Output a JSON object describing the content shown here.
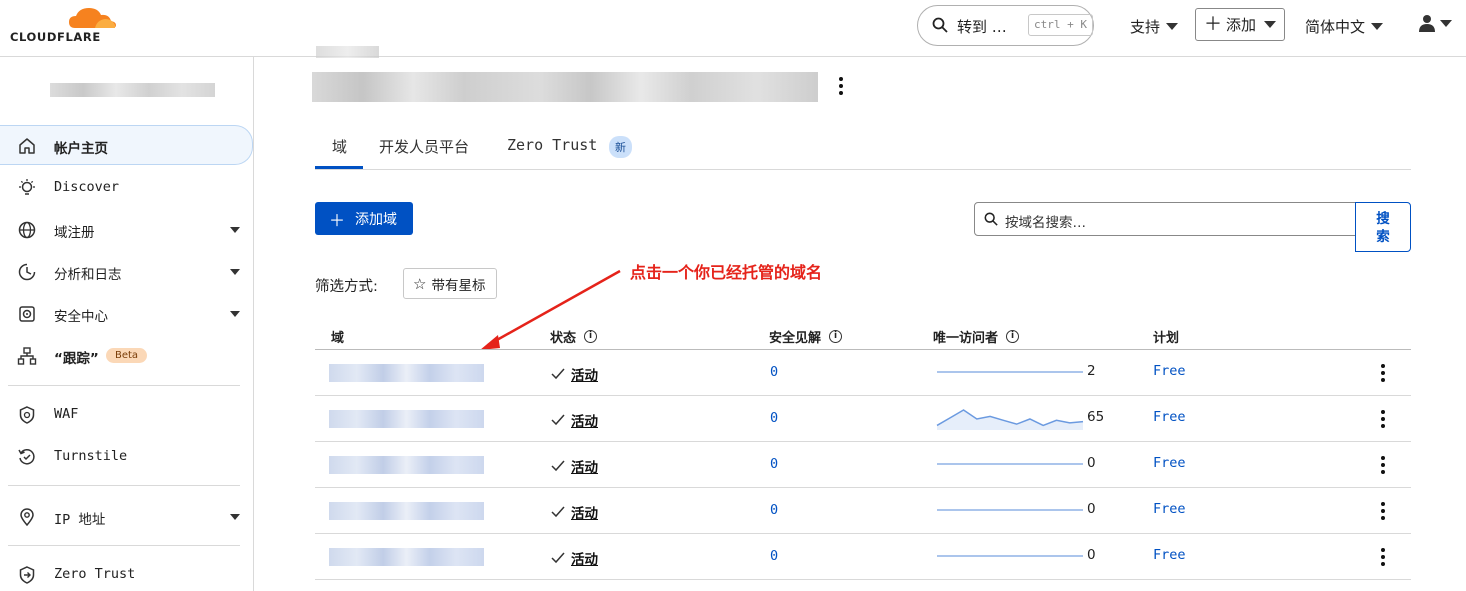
{
  "topbar": {
    "brand": "CLOUDFLARE",
    "goto_label": "转到 …",
    "goto_shortcut": "ctrl + K",
    "support": "支持",
    "add": "添加",
    "language": "简体中文"
  },
  "sidebar": {
    "items": [
      {
        "label": "帐户主页",
        "icon": "home-icon",
        "active": true
      },
      {
        "label": "Discover",
        "icon": "lightbulb-icon"
      },
      {
        "label": "域注册",
        "icon": "globe-icon",
        "expand": true
      },
      {
        "label": "分析和日志",
        "icon": "chart-clock-icon",
        "expand": true
      },
      {
        "label": "安全中心",
        "icon": "shield-target-icon",
        "expand": true
      },
      {
        "label": "“跟踪”",
        "icon": "sitemap-icon",
        "badge": "Beta"
      },
      {
        "label": "WAF",
        "icon": "waf-shield-icon"
      },
      {
        "label": "Turnstile",
        "icon": "turnstile-icon"
      },
      {
        "label": "IP 地址",
        "icon": "location-pin-icon",
        "expand": true
      },
      {
        "label": "Zero Trust",
        "icon": "zero-trust-icon"
      }
    ]
  },
  "main": {
    "tabs": [
      {
        "label": "域",
        "active": true
      },
      {
        "label": "开发人员平台"
      },
      {
        "label": "Zero Trust",
        "badge": "新"
      }
    ],
    "add_domain_button": "添加域",
    "search_placeholder": "按域名搜索…",
    "search_button": "搜索",
    "filter_label": "筛选方式:",
    "filter_starred": "带有星标",
    "annotation": "点击一个你已经托管的域名",
    "table": {
      "headers": {
        "domain": "域",
        "status": "状态",
        "security": "安全见解",
        "visitors": "唯一访问者",
        "plan": "计划"
      },
      "rows": [
        {
          "status": "活动",
          "security": "0",
          "visitors": "2",
          "plan": "Free",
          "spark": [
            0,
            0,
            0,
            0,
            0,
            0,
            0,
            0,
            0,
            0
          ]
        },
        {
          "status": "活动",
          "security": "0",
          "visitors": "65",
          "plan": "Free",
          "spark": [
            2,
            8,
            14,
            7,
            9,
            6,
            3,
            7,
            2,
            6,
            4,
            5
          ]
        },
        {
          "status": "活动",
          "security": "0",
          "visitors": "0",
          "plan": "Free",
          "spark": [
            0,
            0,
            0,
            0,
            0,
            0,
            0,
            0,
            0,
            0
          ]
        },
        {
          "status": "活动",
          "security": "0",
          "visitors": "0",
          "plan": "Free",
          "spark": [
            0,
            0,
            0,
            0,
            0,
            0,
            0,
            0,
            0,
            0
          ]
        },
        {
          "status": "活动",
          "security": "0",
          "visitors": "0",
          "plan": "Free",
          "spark": [
            0,
            0,
            0,
            0,
            0,
            0,
            0,
            0,
            0,
            0
          ]
        }
      ]
    }
  },
  "colors": {
    "accent": "#0051c3",
    "brand_orange": "#f6821f",
    "annotation": "#e5231a"
  }
}
